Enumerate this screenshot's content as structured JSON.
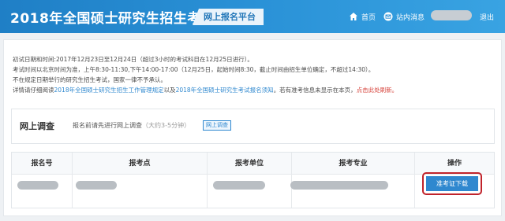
{
  "header": {
    "brand_title": "2018年全国硕士研究生招生考试",
    "platform_label": "网上报名平台",
    "nav_home": "首页",
    "nav_messages": "站内消息",
    "nav_logout": "退出",
    "home_icon": "home-icon",
    "message_icon": "envelope-icon"
  },
  "notes": {
    "line1": "初试日期和时间:2017年12月23日至12月24日（超过3小时的考试科目在12月25日进行）。",
    "line2": "考试时间以北京时间为准，上午8:30-11:30,下午14:00-17:00（12月25日，起始时间8:30，截止时间由招生单位确定，不超过14:30）。",
    "line3": "不在规定日期举行的研究生招生考试，国家一律不予承认。",
    "line4_prefix": "详情请仔细阅读",
    "line4_link1": "2018年全国硕士研究生招生工作管理规定",
    "line4_mid": "以及",
    "line4_link2": "2018年全国硕士研究生考试报名须知",
    "line4_suffix": "。若有准考信息未显示在本页，",
    "line4_link3": "点击此处刷新。"
  },
  "survey": {
    "title": "网上调查",
    "text": "报名前请先进行网上调查",
    "duration": "（大约3-5分钟）",
    "button": "网上调查"
  },
  "table": {
    "headers": [
      "报名号",
      "报考点",
      "报考单位",
      "报考专业",
      "操作"
    ],
    "download_button": "准考证下载"
  },
  "colors": {
    "header_blue": "#2b8fd6",
    "button_blue": "#2f88cf",
    "highlight_red": "#c0232b"
  }
}
